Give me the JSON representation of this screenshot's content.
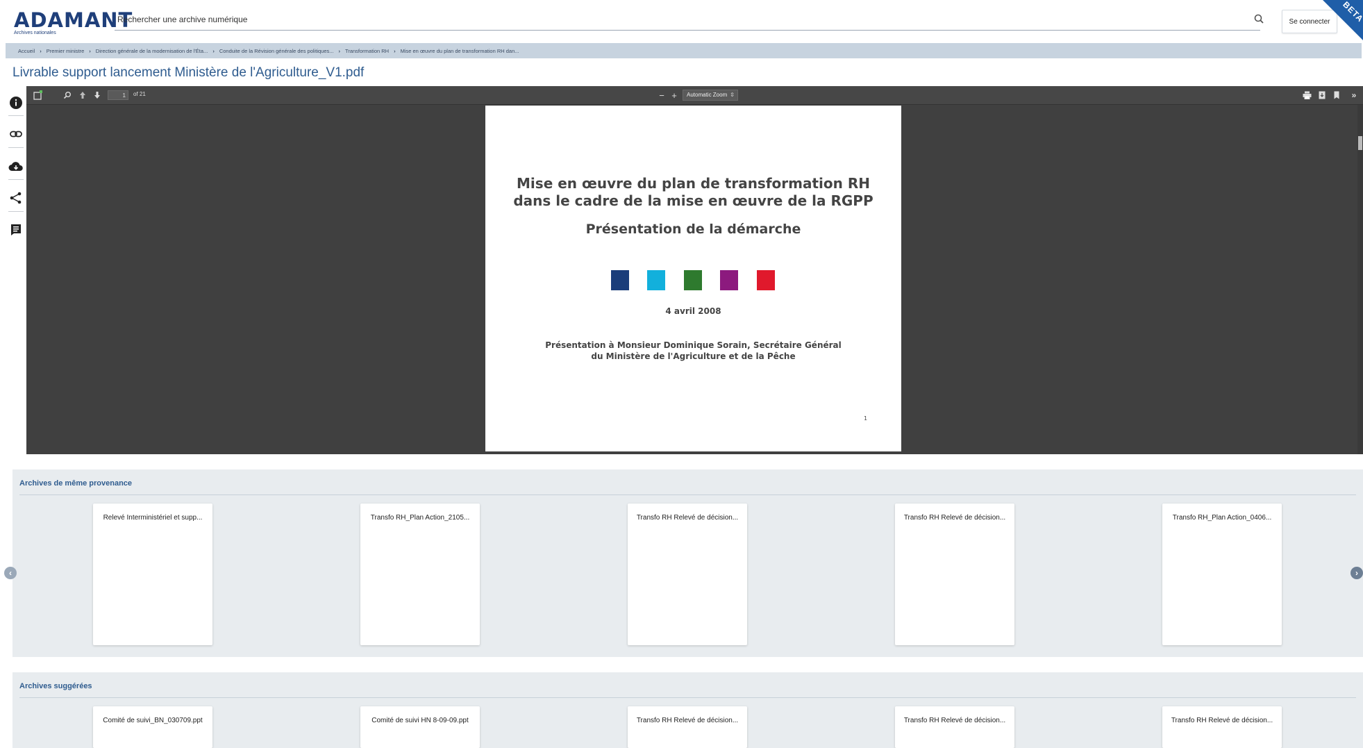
{
  "header": {
    "logo_text": "ADAMANT",
    "logo_subtext": "Archives nationales",
    "search_placeholder": "Rechercher une archive numérique",
    "login_label": "Se connecter",
    "beta_label": "BETA"
  },
  "breadcrumb": [
    "Accueil",
    "Premier ministre",
    "Direction générale de la modernisation de l'Éta...",
    "Conduite de la Révision générale des politiques...",
    "Transformation RH",
    "Mise en œuvre du plan de transformation RH dan..."
  ],
  "document": {
    "title": "Livrable support lancement Ministère de l'Agriculture_V1.pdf"
  },
  "side_tools": [
    "info-icon",
    "link-icon",
    "cloud-download-icon",
    "share-icon",
    "comment-icon"
  ],
  "pdf_viewer": {
    "page_current": "1",
    "page_total_label": "of 21",
    "zoom_label": "Automatic Zoom",
    "zoom_out": "−",
    "zoom_in": "+",
    "page": {
      "title_line1": "Mise en œuvre du plan de transformation RH",
      "title_line2": "dans le cadre de la mise en œuvre de la RGPP",
      "subtitle": "Présentation de la démarche",
      "squares": [
        "#1a3d7a",
        "#12b0dc",
        "#2e7a2e",
        "#8c1a7e",
        "#e0192c"
      ],
      "date": "4 avril 2008",
      "presentation_line1": "Présentation à Monsieur Dominique Sorain, Secrétaire Général",
      "presentation_line2": "du Ministère de l'Agriculture et de la Pêche",
      "page_number": "1"
    }
  },
  "same_provenance": {
    "title": "Archives de même provenance",
    "items": [
      "Relevé Interministériel et supp...",
      "Transfo RH_Plan Action_2105...",
      "Transfo RH Relevé de décision...",
      "Transfo RH Relevé de décision...",
      "Transfo RH_Plan Action_0406..."
    ]
  },
  "suggested": {
    "title": "Archives suggérées",
    "items": [
      "Comité de suivi_BN_030709.ppt",
      "Comité de suivi HN 8-09-09.ppt",
      "Transfo RH Relevé de décision...",
      "Transfo RH Relevé de décision...",
      "Transfo RH Relevé de décision..."
    ]
  },
  "colors": {
    "accent": "#2f5c8f",
    "beta_ribbon": "#1f5ea8",
    "breadcrumb_bg": "#c7d3df",
    "viewer_bg": "#404040"
  }
}
